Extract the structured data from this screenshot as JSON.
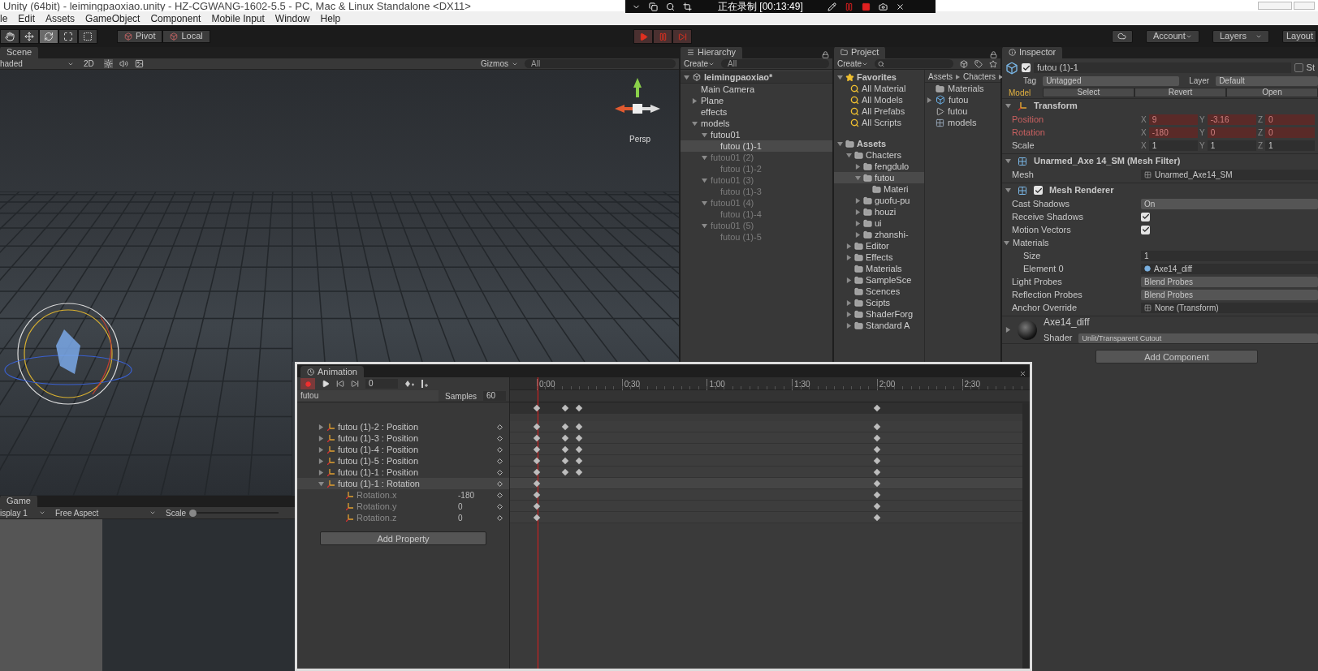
{
  "window": {
    "title": "Unity (64bit) - leimingpaoxiao.unity - HZ-CGWANG-1602-5.5 - PC, Mac & Linux Standalone <DX11>"
  },
  "recorder": {
    "status": "正在录制 [00:13:49]"
  },
  "menu": [
    "le",
    "Edit",
    "Assets",
    "GameObject",
    "Component",
    "Mobile Input",
    "Window",
    "Help"
  ],
  "toolbar": {
    "tools": [
      {
        "kind": "hand",
        "selected": false
      },
      {
        "kind": "move",
        "selected": false
      },
      {
        "kind": "rotate",
        "selected": true
      },
      {
        "kind": "scale",
        "selected": false
      },
      {
        "kind": "rect",
        "selected": false
      }
    ],
    "pivot": "Pivot",
    "local": "Local",
    "account": "Account",
    "layers": "Layers",
    "layout": "Layout"
  },
  "scene": {
    "tab": "Scene",
    "shading": "haded",
    "mode_2d": "2D",
    "gizmos": "Gizmos",
    "search_placeholder": "All",
    "projection": "Persp"
  },
  "game": {
    "tab": "Game",
    "display": "isplay 1",
    "aspect": "Free Aspect",
    "scale_label": "Scale",
    "scale": {
      "level": 0
    }
  },
  "hierarchy": {
    "tab": "Hierarchy",
    "create": "Create",
    "search_placeholder": "All",
    "scene": "leimingpaoxiao*",
    "items": [
      {
        "label": "Main Camera",
        "selected": false,
        "active": true
      },
      {
        "label": "Plane",
        "selected": false,
        "active": true,
        "expanded": false
      },
      {
        "label": "effects",
        "selected": false,
        "active": true
      },
      {
        "label": "models",
        "selected": false,
        "active": true,
        "expanded": true,
        "children": [
          {
            "label": "futou01",
            "selected": false,
            "active": true,
            "expanded": true,
            "children": [
              {
                "label": "futou (1)-1",
                "selected": true,
                "active": true
              }
            ]
          },
          {
            "label": "futou01 (2)",
            "selected": false,
            "active": false,
            "expanded": true,
            "children": [
              {
                "label": "futou (1)-2",
                "selected": false,
                "active": false
              }
            ]
          },
          {
            "label": "futou01 (3)",
            "selected": false,
            "active": false,
            "expanded": true,
            "children": [
              {
                "label": "futou (1)-3",
                "selected": false,
                "active": false
              }
            ]
          },
          {
            "label": "futou01 (4)",
            "selected": false,
            "active": false,
            "expanded": true,
            "children": [
              {
                "label": "futou (1)-4",
                "selected": false,
                "active": false
              }
            ]
          },
          {
            "label": "futou01 (5)",
            "selected": false,
            "active": false,
            "expanded": true,
            "children": [
              {
                "label": "futou (1)-5",
                "selected": false,
                "active": false
              }
            ]
          }
        ]
      }
    ]
  },
  "project": {
    "tab": "Project",
    "create": "Create",
    "favorites": {
      "label": "Favorites",
      "items": [
        "All Material",
        "All Models",
        "All Prefabs",
        "All Scripts"
      ]
    },
    "assets": {
      "label": "Assets",
      "expanded": true,
      "children": [
        {
          "label": "Chacters",
          "selected": false,
          "expanded": true,
          "children": [
            {
              "label": "fengdulo",
              "selected": false,
              "expanded": false
            },
            {
              "label": "futou",
              "selected": true,
              "expanded": true,
              "children": [
                {
                  "label": "Materi",
                  "selected": false
                }
              ]
            },
            {
              "label": "guofu-pu",
              "selected": false,
              "expanded": false
            },
            {
              "label": "houzi",
              "selected": false,
              "expanded": false
            },
            {
              "label": "ui",
              "selected": false,
              "expanded": false
            },
            {
              "label": "zhanshi-",
              "selected": false,
              "expanded": false
            }
          ]
        },
        {
          "label": "Editor",
          "selected": false,
          "expanded": false
        },
        {
          "label": "Effects",
          "selected": false,
          "expanded": false
        },
        {
          "label": "Materials",
          "selected": false
        },
        {
          "label": "SampleSce",
          "selected": false,
          "expanded": false
        },
        {
          "label": "Scences",
          "selected": false
        },
        {
          "label": "Scipts",
          "selected": false,
          "expanded": false
        },
        {
          "label": "ShaderForg",
          "selected": false,
          "expanded": false
        },
        {
          "label": "Standard A",
          "selected": false,
          "expanded": false
        }
      ]
    },
    "breadcrumb": [
      "Assets",
      "Chacters"
    ],
    "files": [
      {
        "name": "Materials",
        "kind": "folder"
      },
      {
        "name": "futou",
        "kind": "model",
        "expanded": false
      },
      {
        "name": "futou",
        "kind": "animation"
      },
      {
        "name": "models",
        "kind": "prefab"
      }
    ]
  },
  "inspector": {
    "tab": "Inspector",
    "enabled": true,
    "name": "futou (1)-1",
    "static": false,
    "static_label": "St",
    "tag_label": "Tag",
    "tag": "Untagged",
    "layer_label": "Layer",
    "layer": "Default",
    "model_label": "Model",
    "model_buttons": [
      "Select",
      "Revert",
      "Open"
    ],
    "components": [
      {
        "kind": "transform",
        "title": "Transform",
        "expanded": true,
        "rows": [
          {
            "kind": "vector",
            "label": "Position",
            "animated": true,
            "fields": [
              {
                "axis": "X",
                "value": "9"
              },
              {
                "axis": "Y",
                "value": "-3.16"
              },
              {
                "axis": "Z",
                "value": "0"
              }
            ]
          },
          {
            "kind": "vector",
            "label": "Rotation",
            "animated": true,
            "fields": [
              {
                "axis": "X",
                "value": "-180"
              },
              {
                "axis": "Y",
                "value": "0"
              },
              {
                "axis": "Z",
                "value": "0"
              }
            ]
          },
          {
            "kind": "vector",
            "label": "Scale",
            "animated": false,
            "fields": [
              {
                "axis": "X",
                "value": "1"
              },
              {
                "axis": "Y",
                "value": "1"
              },
              {
                "axis": "Z",
                "value": "1"
              }
            ]
          }
        ]
      },
      {
        "kind": "mesh_filter",
        "title": "Unarmed_Axe 14_SM (Mesh Filter)",
        "expanded": true,
        "rows": [
          {
            "kind": "object",
            "label": "Mesh",
            "value": "Unarmed_Axe14_SM"
          }
        ]
      },
      {
        "kind": "mesh_renderer",
        "title": "Mesh Renderer",
        "enabled": true,
        "expanded": true,
        "rows": [
          {
            "kind": "dropdown",
            "label": "Cast Shadows",
            "value": "On"
          },
          {
            "kind": "checkbox",
            "label": "Receive Shadows",
            "checked": true
          },
          {
            "kind": "checkbox",
            "label": "Motion Vectors",
            "checked": true
          },
          {
            "kind": "foldout",
            "label": "Materials",
            "expanded": true,
            "children": [
              {
                "kind": "field",
                "label": "Size",
                "value": "1"
              },
              {
                "kind": "material",
                "label": "Element 0",
                "value": "Axe14_diff"
              }
            ]
          },
          {
            "kind": "dropdown",
            "label": "Light Probes",
            "value": "Blend Probes"
          },
          {
            "kind": "dropdown",
            "label": "Reflection Probes",
            "value": "Blend Probes"
          },
          {
            "kind": "object",
            "label": "Anchor Override",
            "value": "None (Transform)"
          }
        ]
      }
    ],
    "material": {
      "name": "Axe14_diff",
      "shader_label": "Shader",
      "shader": "Unlit/Transparent Cutout",
      "expanded": false
    },
    "add_component": "Add Component"
  },
  "animation": {
    "title": "Animation",
    "recording": true,
    "frame": "0",
    "clip": "futou",
    "samples_label": "Samples",
    "samples": "60",
    "ruler": [
      "0:00",
      "0:30",
      "1:00",
      "1:30",
      "2:00",
      "2:30"
    ],
    "playhead": {
      "level": 0
    },
    "summary_keys": [
      {
        "level": 0
      },
      {
        "level": 0.0625
      },
      {
        "level": 0.094
      },
      {
        "level": 0.75
      }
    ],
    "tracks": [
      {
        "label": "futou (1)-2 : Position",
        "selected": false,
        "expanded": false,
        "keys": [
          {
            "level": 0
          },
          {
            "level": 0.0625
          },
          {
            "level": 0.094
          },
          {
            "level": 0.75
          }
        ]
      },
      {
        "label": "futou (1)-3 : Position",
        "selected": false,
        "expanded": false,
        "keys": [
          {
            "level": 0
          },
          {
            "level": 0.0625
          },
          {
            "level": 0.094
          },
          {
            "level": 0.75
          }
        ]
      },
      {
        "label": "futou (1)-4 : Position",
        "selected": false,
        "expanded": false,
        "keys": [
          {
            "level": 0
          },
          {
            "level": 0.0625
          },
          {
            "level": 0.094
          },
          {
            "level": 0.75
          }
        ]
      },
      {
        "label": "futou (1)-5 : Position",
        "selected": false,
        "expanded": false,
        "keys": [
          {
            "level": 0
          },
          {
            "level": 0.0625
          },
          {
            "level": 0.094
          },
          {
            "level": 0.75
          }
        ]
      },
      {
        "label": "futou (1)-1 : Position",
        "selected": false,
        "expanded": false,
        "keys": [
          {
            "level": 0
          },
          {
            "level": 0.0625
          },
          {
            "level": 0.094
          },
          {
            "level": 0.75
          }
        ]
      },
      {
        "label": "futou (1)-1 : Rotation",
        "selected": true,
        "expanded": true,
        "keys": [
          {
            "level": 0
          },
          {
            "level": 0.75
          }
        ],
        "children": [
          {
            "label": "Rotation.x",
            "value": "-180",
            "keys": [
              {
                "level": 0
              },
              {
                "level": 0.75
              }
            ]
          },
          {
            "label": "Rotation.y",
            "value": "0",
            "keys": [
              {
                "level": 0
              },
              {
                "level": 0.75
              }
            ]
          },
          {
            "label": "Rotation.z",
            "value": "0",
            "keys": [
              {
                "level": 0
              },
              {
                "level": 0.75
              }
            ]
          }
        ]
      }
    ],
    "add_property": "Add Property"
  }
}
